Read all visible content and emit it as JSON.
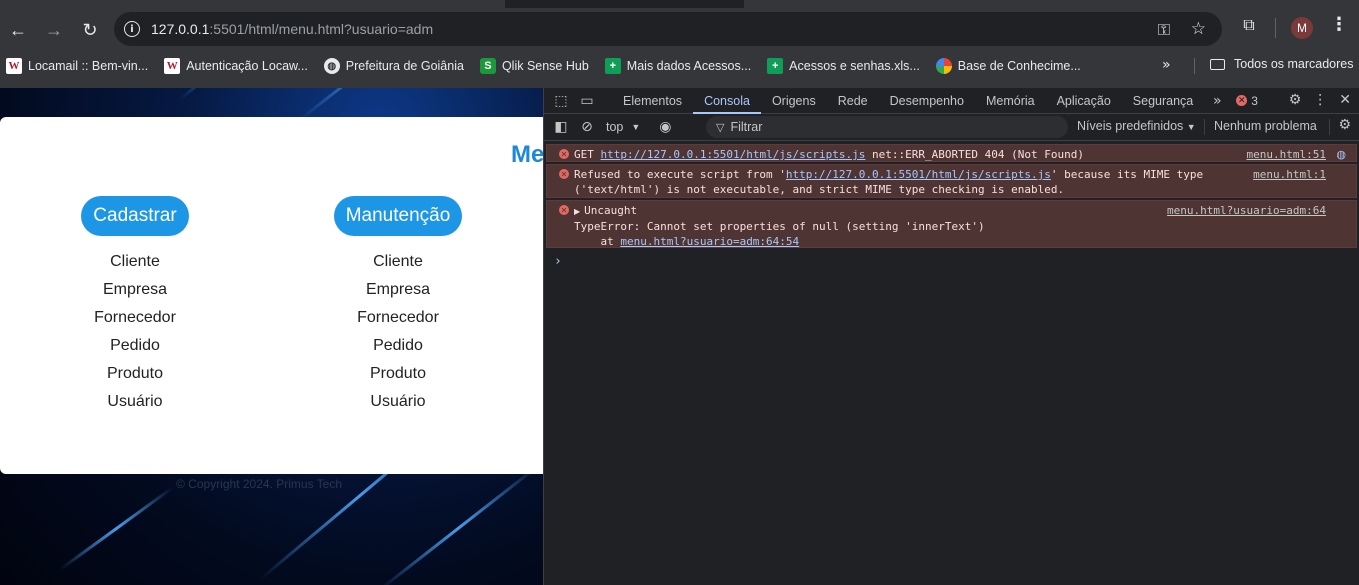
{
  "browser": {
    "url_host": "127.0.0.1",
    "url_rest": ":5501/html/menu.html?usuario=adm",
    "profile_initial": "M",
    "bookmarks": [
      {
        "label": "Locamail :: Bem-vin...",
        "icon": "webmail-w-icon"
      },
      {
        "label": "Autenticação Locaw...",
        "icon": "webmail-w-icon"
      },
      {
        "label": "Prefeitura de Goiânia",
        "icon": "globe-icon"
      },
      {
        "label": "Qlik Sense Hub",
        "icon": "qlik-icon"
      },
      {
        "label": "Mais dados Acessos...",
        "icon": "sheets-icon"
      },
      {
        "label": "Acessos e senhas.xls...",
        "icon": "sheets-icon"
      },
      {
        "label": "Base de Conhecime...",
        "icon": "drive-icon"
      }
    ],
    "all_bookmarks": "Todos os marcadores"
  },
  "page": {
    "title_partial": "Me",
    "columns": [
      {
        "heading": "Cadastrar",
        "items": [
          "Cliente",
          "Empresa",
          "Fornecedor",
          "Pedido",
          "Produto",
          "Usuário"
        ]
      },
      {
        "heading": "Manutenção",
        "items": [
          "Cliente",
          "Empresa",
          "Fornecedor",
          "Pedido",
          "Produto",
          "Usuário"
        ]
      }
    ],
    "copyright": "© Copyright 2024. Primus Tech"
  },
  "devtools": {
    "tabs": [
      "Elementos",
      "Consola",
      "Origens",
      "Rede",
      "Desempenho",
      "Memória",
      "Aplicação",
      "Segurança"
    ],
    "active_tab": "Consola",
    "error_count": "3",
    "context": "top",
    "filter_placeholder": "Filtrar",
    "levels": "Níveis predefinidos",
    "issues": "Nenhum problema",
    "messages": [
      {
        "pre": "GET ",
        "link": "http://127.0.0.1:5501/html/js/scripts.js",
        "post": " net::ERR_ABORTED 404 (Not Found)",
        "source": "menu.html:51"
      },
      {
        "pre": "Refused to execute script from '",
        "link": "http://127.0.0.1:5501/html/js/scripts.js",
        "post": "' because its MIME type",
        "line2": "('text/html') is not executable, and strict MIME type checking is enabled.",
        "source": "menu.html:1"
      },
      {
        "line1": "Uncaught",
        "line2": "TypeError: Cannot set properties of null (setting 'innerText')",
        "line3_pre": "    at ",
        "line3_link": "menu.html?usuario=adm:64:54",
        "source": "menu.html?usuario=adm:64"
      }
    ]
  },
  "colors": {
    "accent": "#1e96e6",
    "error_bg": "#4e3534",
    "devtools_bg": "#202124"
  }
}
